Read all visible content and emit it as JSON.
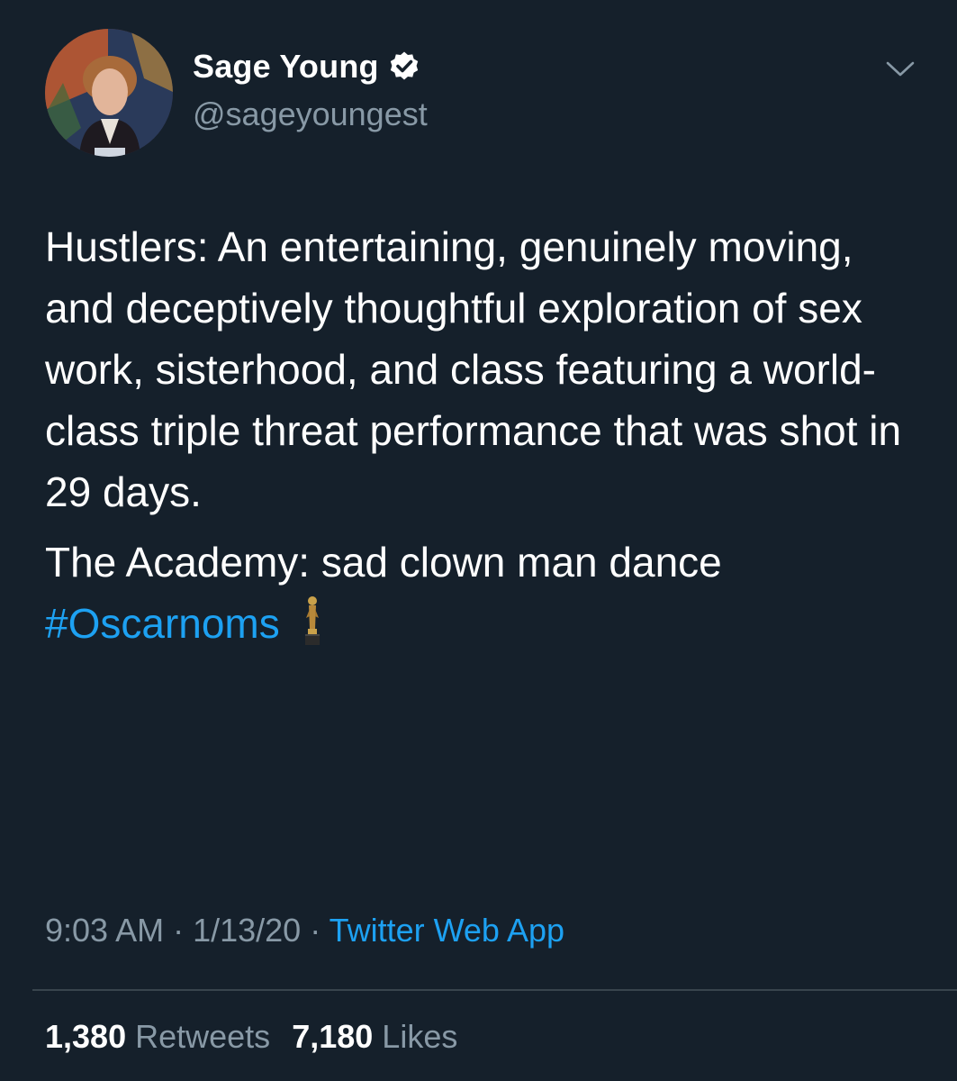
{
  "author": {
    "display_name": "Sage Young",
    "handle": "@sageyoungest",
    "verified": true,
    "verified_icon": "verified-badge-icon"
  },
  "tweet": {
    "paragraph1": "Hustlers: An entertaining, genuinely moving, and deceptively thoughtful exploration of sex work, sisterhood, and class featuring a world-class triple threat performance that was shot in 29 days.",
    "paragraph2_text": "The Academy: sad clown man dance",
    "hashtag": "#Oscarnoms",
    "emoji_icon": "oscar-trophy-icon"
  },
  "meta": {
    "time": "9:03 AM",
    "separator1": " · ",
    "date": "1/13/20",
    "separator2": " · ",
    "source": "Twitter Web App"
  },
  "stats": {
    "retweets_count": "1,380",
    "retweets_label": "Retweets",
    "likes_count": "7,180",
    "likes_label": "Likes"
  },
  "colors": {
    "background": "#15202b",
    "text": "#ffffff",
    "secondary": "#8899a6",
    "accent": "#1da1f2",
    "divider": "#38444d"
  }
}
